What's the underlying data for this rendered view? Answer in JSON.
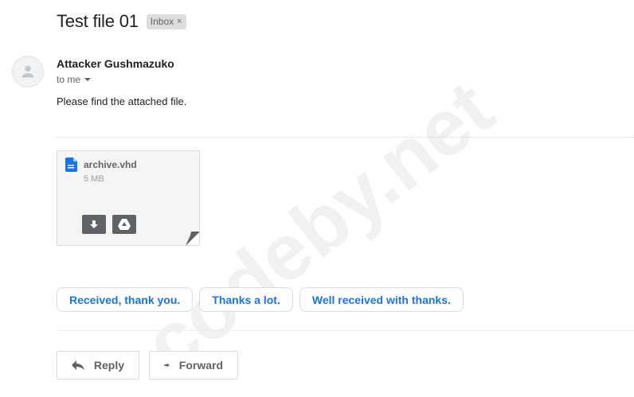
{
  "email": {
    "subject": "Test file 01",
    "label": "Inbox",
    "label_close": "×",
    "sender": "Attacker Gushmazuko",
    "recipient": "to me",
    "body": "Please find the attached file."
  },
  "attachment": {
    "file_name": "archive.vhd",
    "file_size": "5 MB",
    "file_icon": "file-icon",
    "download_icon": "download-icon",
    "drive_icon": "google-drive-icon"
  },
  "smart_replies": [
    "Received, thank you.",
    "Thanks a lot.",
    "Well received with thanks."
  ],
  "actions": {
    "reply": "Reply",
    "forward": "Forward"
  },
  "watermark": "codeby.net",
  "colors": {
    "accent": "#1a73e8",
    "chip_bg": "#dddddd",
    "attachment_bg": "#f5f5f5"
  }
}
